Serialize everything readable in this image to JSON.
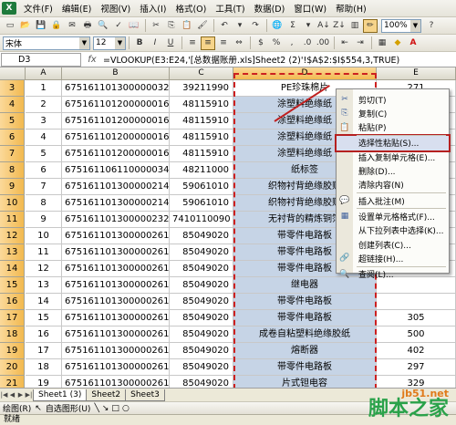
{
  "menubar": {
    "items": [
      "文件(F)",
      "编辑(E)",
      "视图(V)",
      "插入(I)",
      "格式(O)",
      "工具(T)",
      "数据(D)",
      "窗口(W)",
      "帮助(H)"
    ]
  },
  "toolbar": {
    "zoom": "100%"
  },
  "format_toolbar": {
    "font_name": "宋体",
    "font_size": "12",
    "bold": "B",
    "italic": "I",
    "underline": "U"
  },
  "formula_bar": {
    "name_box": "D3",
    "fx": "fx",
    "formula": "=VLOOKUP(E3:E24,'[总数据账册.xls]Sheet2 (2)'!$A$2:$I$554,3,TRUE)"
  },
  "columns": [
    "A",
    "B",
    "C",
    "D",
    "E"
  ],
  "rows": [
    {
      "n": "3",
      "a": "1",
      "b": "6751611013000000329",
      "c": "39211990",
      "d": "PE珍珠棉片",
      "e": "271"
    },
    {
      "n": "4",
      "a": "2",
      "b": "6751611012000000161",
      "c": "48115910",
      "d": "涂塑料绝缘纸",
      "e": ""
    },
    {
      "n": "5",
      "a": "3",
      "b": "6751611012000000161",
      "c": "48115910",
      "d": "涂塑料绝缘纸",
      "e": ""
    },
    {
      "n": "6",
      "a": "4",
      "b": "6751611012000000161",
      "c": "48115910",
      "d": "涂塑料绝缘纸",
      "e": ""
    },
    {
      "n": "7",
      "a": "5",
      "b": "6751611012000000161",
      "c": "48115910",
      "d": "涂塑料绝缘纸",
      "e": ""
    },
    {
      "n": "8",
      "a": "6",
      "b": "6751611061100000346",
      "c": "48211000",
      "d": "纸标签",
      "e": ""
    },
    {
      "n": "9",
      "a": "7",
      "b": "6751611013000002148",
      "c": "59061010",
      "d": "织物衬背绝缘胶贴",
      "e": ""
    },
    {
      "n": "10",
      "a": "8",
      "b": "6751611013000002148",
      "c": "59061010",
      "d": "织物衬背绝缘胶贴",
      "e": ""
    },
    {
      "n": "11",
      "a": "9",
      "b": "6751611013000002322",
      "c": "7410110090",
      "d": "无衬背的精炼铜箔",
      "e": ""
    },
    {
      "n": "12",
      "a": "10",
      "b": "6751611013000002610",
      "c": "85049020",
      "d": "带零件电路板",
      "e": ""
    },
    {
      "n": "13",
      "a": "11",
      "b": "6751611013000002611",
      "c": "85049020",
      "d": "带零件电路板",
      "e": ""
    },
    {
      "n": "14",
      "a": "12",
      "b": "6751611013000002614",
      "c": "85049020",
      "d": "带零件电路板",
      "e": ""
    },
    {
      "n": "15",
      "a": "13",
      "b": "6751611013000002614",
      "c": "85049020",
      "d": "继电器",
      "e": ""
    },
    {
      "n": "16",
      "a": "14",
      "b": "6751611013000002614",
      "c": "85049020",
      "d": "带零件电路板",
      "e": ""
    },
    {
      "n": "17",
      "a": "15",
      "b": "6751611013000002614",
      "c": "85049020",
      "d": "带零件电路板",
      "e": "305"
    },
    {
      "n": "18",
      "a": "16",
      "b": "6751611013000002614",
      "c": "85049020",
      "d": "成卷自粘塑料绝缘胶纸",
      "e": "500"
    },
    {
      "n": "19",
      "a": "17",
      "b": "6751611013000002614",
      "c": "85049020",
      "d": "熔断器",
      "e": "402"
    },
    {
      "n": "20",
      "a": "18",
      "b": "6751611013000002614",
      "c": "85049020",
      "d": "带零件电路板",
      "e": "297"
    },
    {
      "n": "21",
      "a": "19",
      "b": "6751611013000002614",
      "c": "85049020",
      "d": "片式钽电容",
      "e": "329"
    },
    {
      "n": "22",
      "a": "20",
      "b": "6751611013000002614",
      "c": "85049020",
      "d": "真空固定电容",
      "e": "351"
    },
    {
      "n": "23",
      "a": "21",
      "b": "6751611013000002614",
      "c": "85049020",
      "d": "非片式固定电阻",
      "e": ""
    }
  ],
  "context_menu": {
    "items": [
      {
        "icon": "✂",
        "label": "剪切(T)"
      },
      {
        "icon": "⎘",
        "label": "复制(C)"
      },
      {
        "icon": "📋",
        "label": "粘贴(P)"
      },
      {
        "icon": "",
        "label": "选择性粘贴(S)..."
      },
      {
        "icon": "",
        "label": "插入复制单元格(E)..."
      },
      {
        "icon": "",
        "label": "删除(D)..."
      },
      {
        "icon": "",
        "label": "清除内容(N)"
      },
      {
        "icon": "💬",
        "label": "插入批注(M)"
      },
      {
        "icon": "▦",
        "label": "设置单元格格式(F)..."
      },
      {
        "icon": "",
        "label": "从下拉列表中选择(K)..."
      },
      {
        "icon": "",
        "label": "创建列表(C)..."
      },
      {
        "icon": "🔗",
        "label": "超链接(H)..."
      },
      {
        "icon": "🔍",
        "label": "查阅(L)..."
      }
    ]
  },
  "sheet_tabs": [
    "Sheet1 (3)",
    "Sheet2",
    "Sheet3"
  ],
  "drawing_toolbar": {
    "draw": "绘图(R)",
    "autoshapes": "自选图形(U)"
  },
  "status": "就绪",
  "watermark": {
    "site": "jb51.net",
    "name": "脚本之家"
  }
}
